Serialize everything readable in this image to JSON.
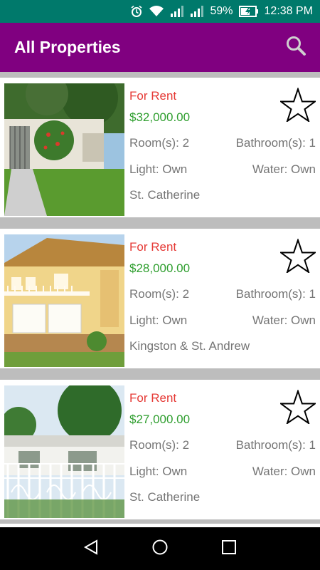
{
  "status_bar": {
    "battery_percent": "59%",
    "time": "12:38 PM",
    "icons": [
      "alarm-icon",
      "wifi-icon",
      "signal-icon",
      "signal-icon",
      "battery-charging-icon"
    ]
  },
  "app_bar": {
    "title": "All Properties",
    "search_icon": "search-icon"
  },
  "colors": {
    "status_bar": "#00796b",
    "app_bar": "#800080",
    "listing_type": "#e53935",
    "price": "#2e9e2e",
    "detail_text": "#757575",
    "list_background": "#bdbdbd"
  },
  "properties": [
    {
      "listing_type": "For Rent",
      "price": "$32,000.00",
      "rooms": "Room(s): 2",
      "bathrooms": "Bathroom(s): 1",
      "light": "Light: Own",
      "water": "Water: Own",
      "location": "St. Catherine",
      "favorite_icon": "star-outline-icon"
    },
    {
      "listing_type": "For Rent",
      "price": "$28,000.00",
      "rooms": "Room(s): 2",
      "bathrooms": "Bathroom(s): 1",
      "light": "Light: Own",
      "water": "Water: Own",
      "location": "Kingston & St. Andrew",
      "favorite_icon": "star-outline-icon"
    },
    {
      "listing_type": "For Rent",
      "price": "$27,000.00",
      "rooms": "Room(s): 2",
      "bathrooms": "Bathroom(s): 1",
      "light": "Light: Own",
      "water": "Water: Own",
      "location": "St. Catherine",
      "favorite_icon": "star-outline-icon"
    }
  ],
  "nav_bar": {
    "icons": [
      "back-icon",
      "home-icon",
      "recents-icon"
    ]
  }
}
